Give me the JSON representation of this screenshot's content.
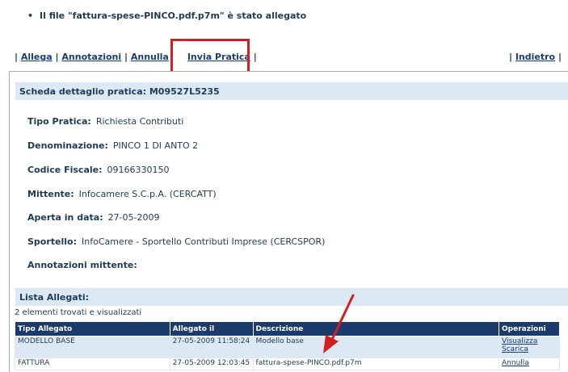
{
  "notice": {
    "bullet": "•",
    "text": "Il file \"fattura-spese-PINCO.pdf.p7m\" è stato allegato"
  },
  "toolbar": {
    "allega": "Allega",
    "annotazioni": "Annotazioni",
    "annulla": "Annulla",
    "invia_pratica": "Invia Pratica",
    "indietro": "Indietro",
    "separator": "|"
  },
  "detail": {
    "header": "Scheda dettaglio pratica: M09527L5235",
    "fields": [
      {
        "label": "Tipo Pratica:",
        "value": "Richiesta Contributi"
      },
      {
        "label": "Denominazione:",
        "value": "PINCO 1 DI ANTO 2"
      },
      {
        "label": "Codice Fiscale:",
        "value": "09166330150"
      },
      {
        "label": "Mittente:",
        "value": "Infocamere S.C.p.A. (CERCATT)"
      },
      {
        "label": "Aperta in data:",
        "value": "27-05-2009"
      },
      {
        "label": "Sportello:",
        "value": "InfoCamere - Sportello Contributi Imprese (CERCSPOR)"
      },
      {
        "label": "Annotazioni mittente:",
        "value": ""
      }
    ]
  },
  "attachments": {
    "header": "Lista Allegati:",
    "found_text": "2 elementi trovati e visualizzati",
    "columns": [
      "Tipo Allegato",
      "Allegato il",
      "Descrizione",
      "Operazioni"
    ],
    "rows": [
      {
        "tipo": "MODELLO BASE",
        "data": "27-05-2009 11:58:24",
        "descrizione": "Modello base",
        "ops": [
          "Visualizza",
          "Scarica"
        ]
      },
      {
        "tipo": "FATTURA",
        "data": "27-05-2009 12:03:45",
        "descrizione": "fattura-spese-PINCO.pdf.p7m",
        "ops": [
          "Annulla"
        ]
      }
    ]
  },
  "colors": {
    "highlight": "#d21f1f",
    "header_bg": "#dce9f5",
    "table_header_bg": "#1c3b6d",
    "arrow": "#d21f1f"
  }
}
